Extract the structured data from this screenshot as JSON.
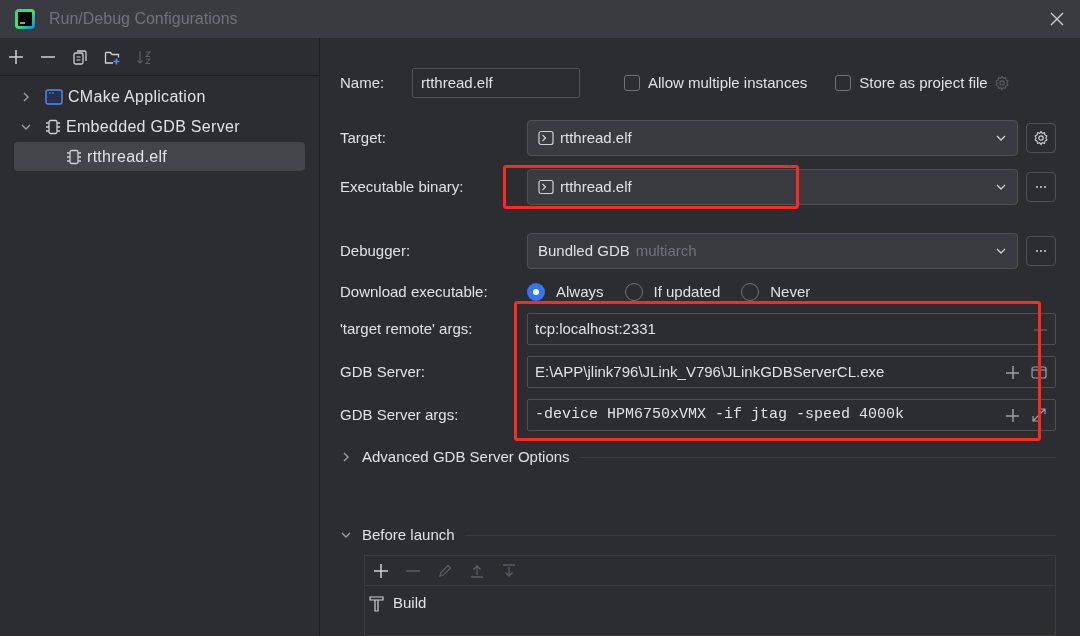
{
  "window": {
    "title": "Run/Debug Configurations"
  },
  "toolbar": [
    {
      "kind": "add",
      "disabled": false
    },
    {
      "kind": "remove",
      "disabled": false
    },
    {
      "kind": "copy",
      "disabled": false
    },
    {
      "kind": "folder",
      "disabled": false
    },
    {
      "kind": "sort",
      "disabled": true
    }
  ],
  "tree": [
    {
      "label": "CMake Application",
      "kind": "cmake",
      "expanded": false
    },
    {
      "label": "Embedded GDB Server",
      "kind": "chip",
      "expanded": true,
      "children": [
        {
          "label": "rtthread.elf",
          "kind": "chip",
          "selected": true
        }
      ]
    }
  ],
  "name": {
    "label": "Name:",
    "value": "rtthread.elf"
  },
  "options": [
    {
      "label": "Allow multiple instances",
      "checked": false
    },
    {
      "label": "Store as project file",
      "checked": false
    }
  ],
  "target": {
    "label": "Target:",
    "value": "rtthread.elf"
  },
  "executable_binary": {
    "label": "Executable binary:",
    "value": "rtthread.elf",
    "highlighted": true
  },
  "debugger": {
    "label": "Debugger:",
    "value": "Bundled GDB",
    "hint": "multiarch"
  },
  "download": {
    "label": "Download executable:",
    "choices": [
      {
        "label": "Always",
        "selected": true
      },
      {
        "label": "If updated",
        "selected": false
      },
      {
        "label": "Never",
        "selected": false
      }
    ]
  },
  "target_remote_args": {
    "label": "'target remote' args:",
    "value": "tcp:localhost:2331",
    "highlighted": true
  },
  "gdb_server": {
    "label": "GDB Server:",
    "value": "E:\\APP\\jlink796\\JLink_V796\\JLinkGDBServerCL.exe",
    "highlighted": true
  },
  "gdb_server_args": {
    "label": "GDB Server args:",
    "value": "-device HPM6750xVMX -if jtag -speed 4000k",
    "highlighted": true
  },
  "advanced": {
    "label": "Advanced GDB Server Options",
    "expanded": false
  },
  "before_launch": {
    "label": "Before launch",
    "expanded": true,
    "toolbar": [
      {
        "kind": "add",
        "disabled": false
      },
      {
        "kind": "remove",
        "disabled": true
      },
      {
        "kind": "edit",
        "disabled": true
      },
      {
        "kind": "up",
        "disabled": true
      },
      {
        "kind": "down",
        "disabled": true
      }
    ],
    "tasks": [
      {
        "label": "Build"
      }
    ]
  }
}
